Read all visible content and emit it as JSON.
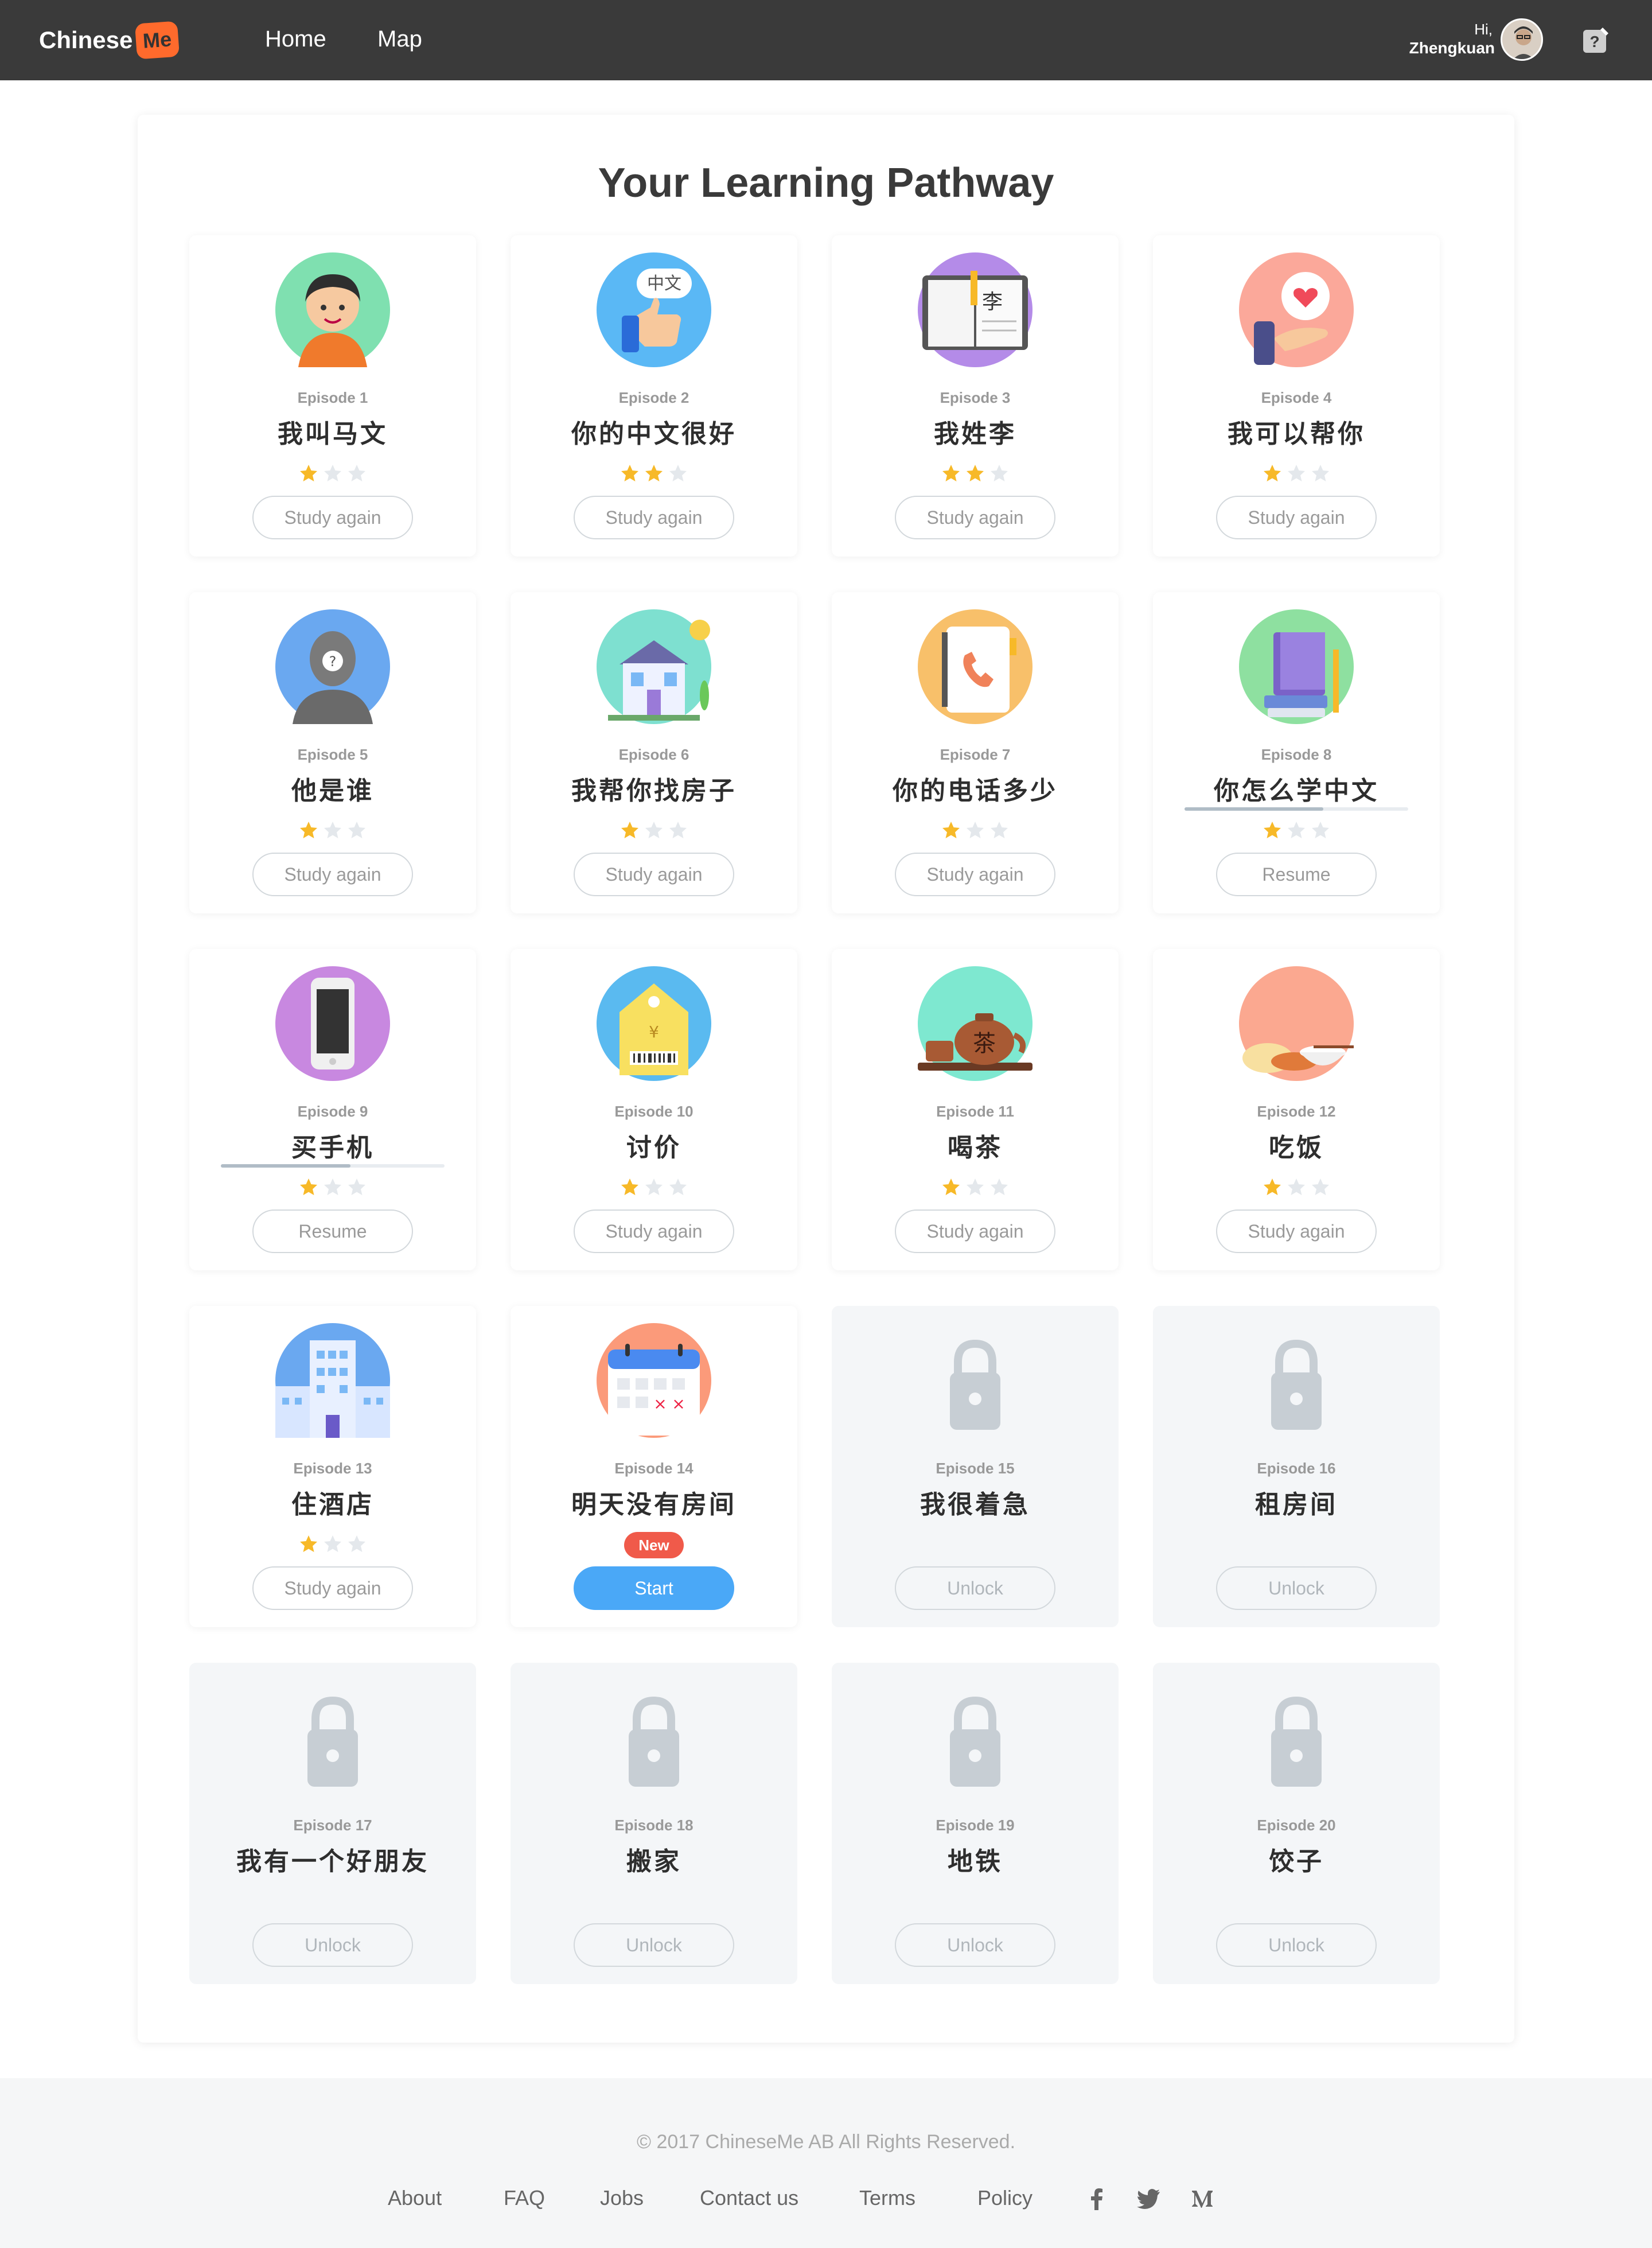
{
  "header": {
    "logo_text": "Chinese",
    "logo_badge": "Me",
    "nav": [
      {
        "label": "Home"
      },
      {
        "label": "Map"
      }
    ],
    "user_greeting": "Hi,",
    "user_name": "Zhengkuan"
  },
  "main": {
    "title": "Your Learning Pathway",
    "episodes": [
      {
        "number": "Episode 1",
        "title": "我叫马文",
        "stars": 1,
        "button": "Study again",
        "state": "done"
      },
      {
        "number": "Episode 2",
        "title": "你的中文很好",
        "stars": 2,
        "button": "Study again",
        "state": "done"
      },
      {
        "number": "Episode 3",
        "title": "我姓李",
        "stars": 2,
        "button": "Study again",
        "state": "done"
      },
      {
        "number": "Episode 4",
        "title": "我可以帮你",
        "stars": 1,
        "button": "Study again",
        "state": "done"
      },
      {
        "number": "Episode 5",
        "title": "他是谁",
        "stars": 1,
        "button": "Study again",
        "state": "done"
      },
      {
        "number": "Episode 6",
        "title": "我帮你找房子",
        "stars": 1,
        "button": "Study again",
        "state": "done"
      },
      {
        "number": "Episode 7",
        "title": "你的电话多少",
        "stars": 1,
        "button": "Study again",
        "state": "done"
      },
      {
        "number": "Episode 8",
        "title": "你怎么学中文",
        "stars": 1,
        "button": "Resume",
        "state": "progress",
        "progress": 0.62
      },
      {
        "number": "Episode 9",
        "title": "买手机",
        "stars": 1,
        "button": "Resume",
        "state": "progress",
        "progress": 0.58
      },
      {
        "number": "Episode 10",
        "title": "讨价",
        "stars": 1,
        "button": "Study again",
        "state": "done"
      },
      {
        "number": "Episode 11",
        "title": "喝茶",
        "stars": 1,
        "button": "Study again",
        "state": "done"
      },
      {
        "number": "Episode 12",
        "title": "吃饭",
        "stars": 1,
        "button": "Study again",
        "state": "done"
      },
      {
        "number": "Episode 13",
        "title": "住酒店",
        "stars": 1,
        "button": "Study again",
        "state": "done"
      },
      {
        "number": "Episode 14",
        "title": "明天没有房间",
        "stars": 0,
        "button": "Start",
        "state": "new",
        "badge": "New"
      },
      {
        "number": "Episode 15",
        "title": "我很着急",
        "stars": 0,
        "button": "Unlock",
        "state": "locked"
      },
      {
        "number": "Episode 16",
        "title": "租房间",
        "stars": 0,
        "button": "Unlock",
        "state": "locked"
      },
      {
        "number": "Episode 17",
        "title": "我有一个好朋友",
        "stars": 0,
        "button": "Unlock",
        "state": "locked"
      },
      {
        "number": "Episode 18",
        "title": "搬家",
        "stars": 0,
        "button": "Unlock",
        "state": "locked"
      },
      {
        "number": "Episode 19",
        "title": "地铁",
        "stars": 0,
        "button": "Unlock",
        "state": "locked"
      },
      {
        "number": "Episode 20",
        "title": "饺子",
        "stars": 0,
        "button": "Unlock",
        "state": "locked"
      }
    ],
    "icons": [
      "boy-avatar-icon",
      "thumbs-up-chinese-icon",
      "book-li-icon",
      "heart-hand-icon",
      "mystery-person-icon",
      "house-icon",
      "phonebook-icon",
      "books-pencil-icon",
      "smartphone-icon",
      "price-tag-icon",
      "teapot-icon",
      "rice-bowl-icon",
      "hotel-building-icon",
      "calendar-icon",
      "lock-icon",
      "lock-icon",
      "lock-icon",
      "lock-icon",
      "lock-icon",
      "lock-icon"
    ]
  },
  "footer": {
    "copyright": "© 2017 ChineseMe AB All Rights Reserved.",
    "links": [
      {
        "label": "About"
      },
      {
        "label": "FAQ"
      },
      {
        "label": "Jobs"
      },
      {
        "label": "Contact us"
      },
      {
        "label": "Terms"
      },
      {
        "label": "Policy"
      }
    ],
    "social": [
      "facebook-icon",
      "twitter-icon",
      "medium-icon"
    ]
  },
  "colors": {
    "topbar": "#3a3a3a",
    "brand": "#ff6a2c",
    "star_on": "#f7b928",
    "star_off": "#e4e8ec",
    "primary_button": "#4aa8f7",
    "new_badge": "#f05a4a"
  }
}
